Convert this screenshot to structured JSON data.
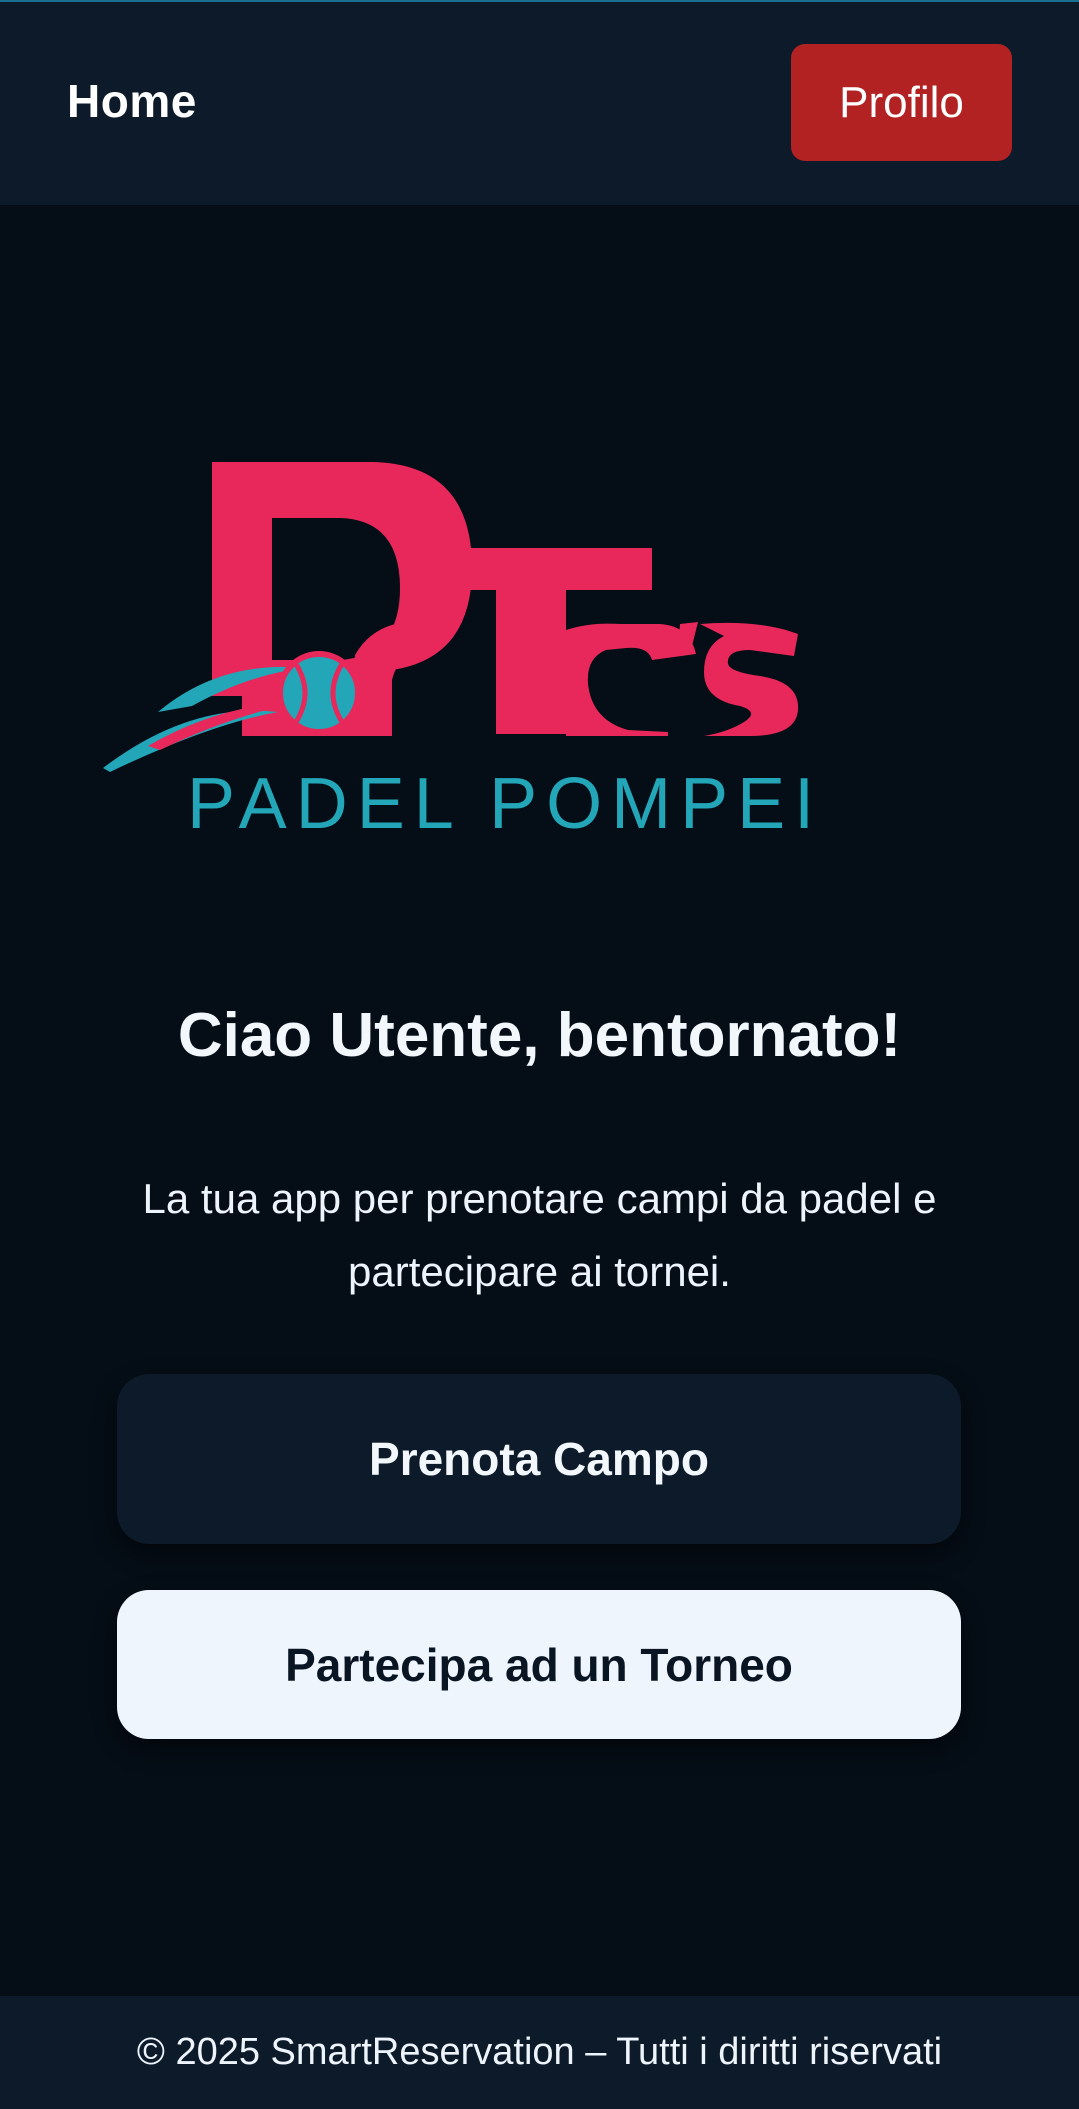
{
  "header": {
    "title": "Home",
    "profile_label": "Profilo"
  },
  "logo": {
    "wordmark": "PorTres",
    "subtitle": "PADEL POMPEI",
    "primary_color": "#e8285a",
    "secondary_color": "#22a6b8"
  },
  "main": {
    "greeting": "Ciao Utente, bentornato!",
    "tagline": "La tua app per prenotare campi da padel e partecipare ai tornei.",
    "book_court_label": "Prenota Campo",
    "join_tournament_label": "Partecipa ad un Torneo"
  },
  "footer": {
    "copyright": "© 2025 SmartReservation – Tutti i diritti riservati"
  },
  "colors": {
    "background": "#050d16",
    "panel": "#0c1a29",
    "accent_red": "#b22222",
    "light_button": "#eef5fd"
  }
}
